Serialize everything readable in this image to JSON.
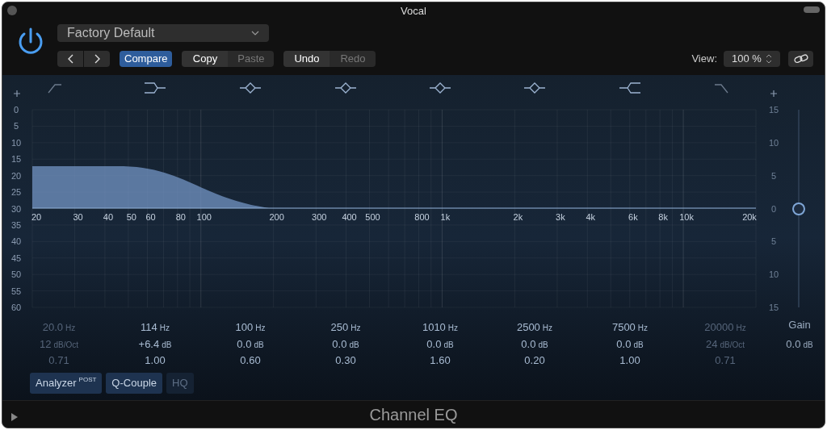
{
  "window": {
    "title": "Vocal"
  },
  "power": {
    "on": true
  },
  "preset": {
    "value": "Factory Default"
  },
  "compare": {
    "label": "Compare",
    "selected": true
  },
  "edit_buttons": [
    {
      "label": "Copy",
      "disabled": false
    },
    {
      "label": "Paste",
      "disabled": true
    }
  ],
  "history_buttons": [
    {
      "label": "Undo",
      "disabled": false
    },
    {
      "label": "Redo",
      "disabled": true
    }
  ],
  "view": {
    "label": "View:",
    "value": "100 %"
  },
  "graph": {
    "db_scale": [
      "0",
      "5",
      "10",
      "15",
      "20",
      "25",
      "30",
      "35",
      "40",
      "45",
      "50",
      "55",
      "60"
    ],
    "gain_scale": [
      "15",
      "10",
      "5",
      "0",
      "5",
      "10",
      "15"
    ],
    "frequency_labels": [
      "20",
      "30",
      "40",
      "50",
      "60",
      "80",
      "100",
      "200",
      "300",
      "400",
      "500",
      "800",
      "1k",
      "2k",
      "3k",
      "4k",
      "6k",
      "8k",
      "10k",
      "20k"
    ]
  },
  "bands": [
    {
      "kind": "lowcut",
      "enabled": false,
      "frequency": "20.0",
      "frequency_unit": "Hz",
      "gain": "12",
      "gain_unit": "dB/Oct",
      "q": "0.71"
    },
    {
      "kind": "lowshelf",
      "enabled": true,
      "frequency": "114",
      "frequency_unit": "Hz",
      "gain": "+6.4",
      "gain_unit": "dB",
      "q": "1.00"
    },
    {
      "kind": "bell",
      "enabled": true,
      "frequency": "100",
      "frequency_unit": "Hz",
      "gain": "0.0",
      "gain_unit": "dB",
      "q": "0.60"
    },
    {
      "kind": "bell",
      "enabled": true,
      "frequency": "250",
      "frequency_unit": "Hz",
      "gain": "0.0",
      "gain_unit": "dB",
      "q": "0.30"
    },
    {
      "kind": "bell",
      "enabled": true,
      "frequency": "1010",
      "frequency_unit": "Hz",
      "gain": "0.0",
      "gain_unit": "dB",
      "q": "1.60"
    },
    {
      "kind": "bell",
      "enabled": true,
      "frequency": "2500",
      "frequency_unit": "Hz",
      "gain": "0.0",
      "gain_unit": "dB",
      "q": "0.20"
    },
    {
      "kind": "highshelf",
      "enabled": true,
      "frequency": "7500",
      "frequency_unit": "Hz",
      "gain": "0.0",
      "gain_unit": "dB",
      "q": "1.00"
    },
    {
      "kind": "highcut",
      "enabled": false,
      "frequency": "20000",
      "frequency_unit": "Hz",
      "gain": "24",
      "gain_unit": "dB/Oct",
      "q": "0.71"
    }
  ],
  "gain": {
    "label": "Gain",
    "value": "0.0",
    "unit": "dB",
    "level": 0.5
  },
  "toggles": [
    {
      "label": "Analyzer",
      "superscript": "POST",
      "on": true
    },
    {
      "label": "Q-Couple",
      "on": true
    },
    {
      "label": "HQ",
      "on": false
    }
  ],
  "footer": {
    "title": "Channel EQ"
  }
}
